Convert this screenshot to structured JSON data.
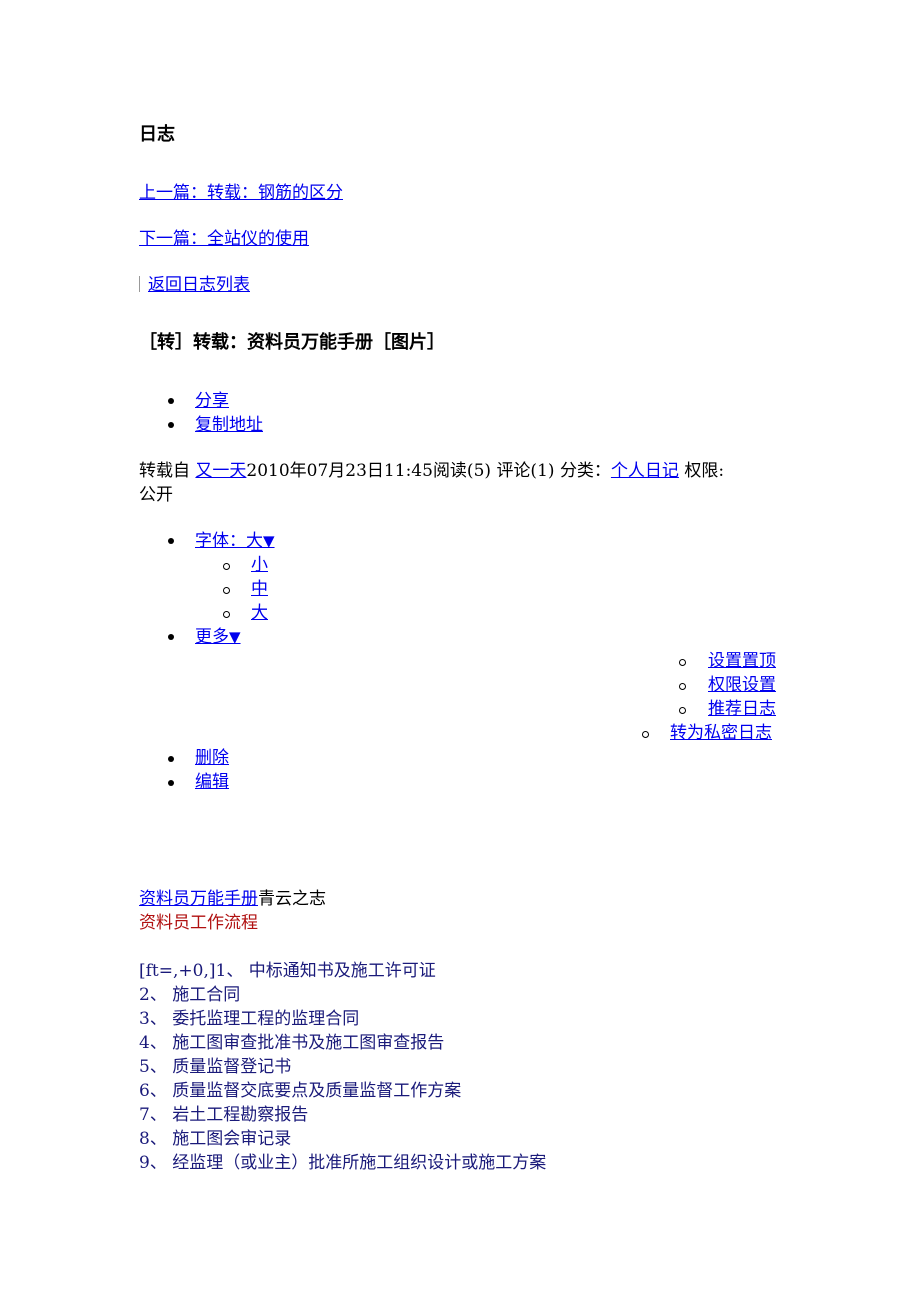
{
  "page": {
    "heading": "日志"
  },
  "nav": {
    "prev": "上一篇：转载：钢筋的区分",
    "next": "下一篇：全站仪的使用",
    "back": "返回日志列表"
  },
  "post": {
    "title": "［转］转载：资料员万能手册［图片］",
    "actions": [
      "分享",
      "复制地址"
    ],
    "meta": {
      "prefix": "转载自",
      "author": "又一天",
      "date": "2010年07月23日11:45",
      "reads": "阅读(5)",
      "comments": "评论(1)",
      "category_label": "分类：",
      "category": "个人日记",
      "permission_label": "权限:",
      "permission": "公开"
    },
    "font_menu": {
      "label": "字体：大",
      "arrow": "▼",
      "options": [
        "小",
        "中",
        "大"
      ]
    },
    "more_menu": {
      "label": "更多",
      "arrow": "▼",
      "options": [
        "设置置顶",
        "权限设置",
        "推荐日志",
        "转为私密日志"
      ]
    },
    "edit_actions": [
      "删除",
      "编辑"
    ]
  },
  "body": {
    "source_link": "资料员万能手册",
    "source_suffix": "青云之志",
    "section_title": "资料员工作流程",
    "prefix": "[ft=,+0,]",
    "items": [
      "1、  中标通知书及施工许可证",
      "2、  施工合同",
      "3、  委托监理工程的监理合同",
      "4、  施工图审查批准书及施工图审查报告",
      "5、  质量监督登记书",
      "6、  质量监督交底要点及质量监督工作方案",
      "7、  岩土工程勘察报告",
      "8、  施工图会审记录",
      "9、  经监理（或业主）批准所施工组织设计或施工方案"
    ]
  },
  "colors": {
    "link": "#0000ee",
    "list_text": "#1a1a7a",
    "section_red": "#b01010"
  }
}
